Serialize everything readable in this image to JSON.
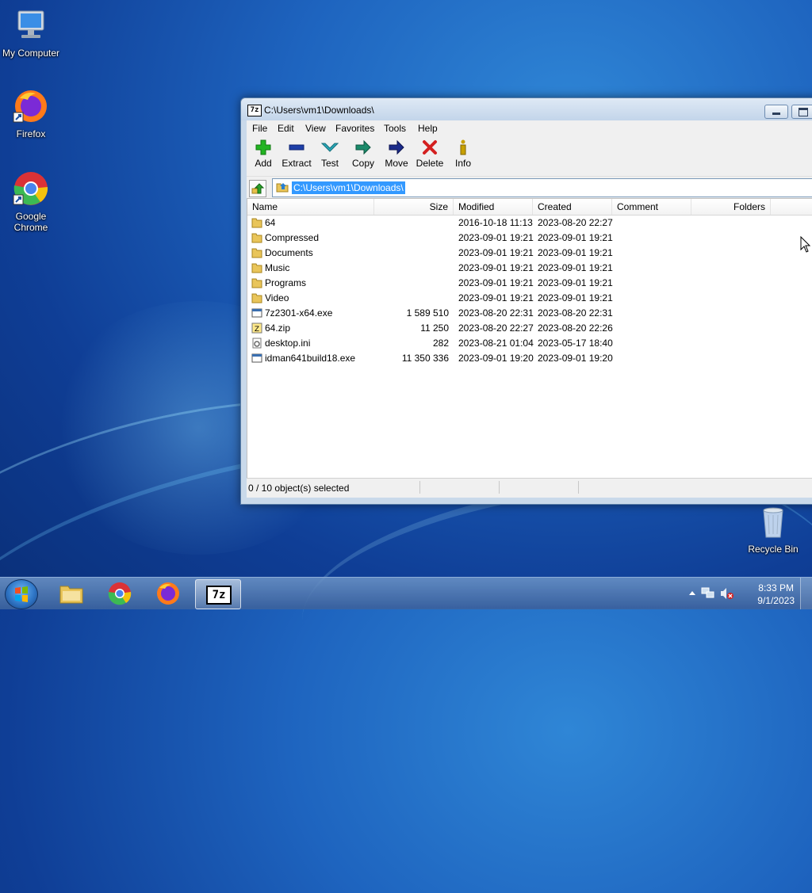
{
  "desktop": {
    "icons": [
      {
        "label": "My Computer",
        "icon": "computer-icon"
      },
      {
        "label": "Firefox",
        "icon": "firefox-icon"
      },
      {
        "label": "Google Chrome",
        "icon": "chrome-icon"
      },
      {
        "label": "Recycle Bin",
        "icon": "recycle-bin-icon"
      }
    ]
  },
  "window": {
    "title": "C:\\Users\\vm1\\Downloads\\",
    "app_icon_text": "7z",
    "menu": [
      "File",
      "Edit",
      "View",
      "Favorites",
      "Tools",
      "Help"
    ],
    "toolbar": [
      {
        "label": "Add",
        "icon": "add-icon",
        "color": "#22b422"
      },
      {
        "label": "Extract",
        "icon": "extract-icon",
        "color": "#1e3fa8"
      },
      {
        "label": "Test",
        "icon": "test-icon",
        "color": "#2aa8b8"
      },
      {
        "label": "Copy",
        "icon": "copy-icon",
        "color": "#1a8a6a"
      },
      {
        "label": "Move",
        "icon": "move-icon",
        "color": "#1a2a8a"
      },
      {
        "label": "Delete",
        "icon": "delete-icon",
        "color": "#d42020"
      },
      {
        "label": "Info",
        "icon": "info-icon",
        "color": "#c8a000"
      }
    ],
    "address": "C:\\Users\\vm1\\Downloads\\",
    "columns": [
      "Name",
      "Size",
      "Modified",
      "Created",
      "Comment",
      "Folders"
    ],
    "files": [
      {
        "name": "64",
        "type": "folder",
        "size": "",
        "modified": "2016-10-18 11:13",
        "created": "2023-08-20 22:27"
      },
      {
        "name": "Compressed",
        "type": "folder",
        "size": "",
        "modified": "2023-09-01 19:21",
        "created": "2023-09-01 19:21"
      },
      {
        "name": "Documents",
        "type": "folder",
        "size": "",
        "modified": "2023-09-01 19:21",
        "created": "2023-09-01 19:21"
      },
      {
        "name": "Music",
        "type": "folder",
        "size": "",
        "modified": "2023-09-01 19:21",
        "created": "2023-09-01 19:21"
      },
      {
        "name": "Programs",
        "type": "folder",
        "size": "",
        "modified": "2023-09-01 19:21",
        "created": "2023-09-01 19:21"
      },
      {
        "name": "Video",
        "type": "folder",
        "size": "",
        "modified": "2023-09-01 19:21",
        "created": "2023-09-01 19:21"
      },
      {
        "name": "7z2301-x64.exe",
        "type": "exe",
        "size": "1 589 510",
        "modified": "2023-08-20 22:31",
        "created": "2023-08-20 22:31"
      },
      {
        "name": "64.zip",
        "type": "zip",
        "size": "11 250",
        "modified": "2023-08-20 22:27",
        "created": "2023-08-20 22:26"
      },
      {
        "name": "desktop.ini",
        "type": "ini",
        "size": "282",
        "modified": "2023-08-21 01:04",
        "created": "2023-05-17 18:40"
      },
      {
        "name": "idman641build18.exe",
        "type": "exe",
        "size": "11 350 336",
        "modified": "2023-09-01 19:20",
        "created": "2023-09-01 19:20"
      }
    ],
    "status": "0 / 10 object(s) selected"
  },
  "taskbar": {
    "apps": [
      {
        "name": "explorer",
        "icon": "folder-icon"
      },
      {
        "name": "chrome",
        "icon": "chrome-icon"
      },
      {
        "name": "firefox",
        "icon": "firefox-icon"
      },
      {
        "name": "7zip",
        "icon": "7zip-icon",
        "text": "7z",
        "active": true
      }
    ],
    "time": "8:33 PM",
    "date": "9/1/2023"
  }
}
